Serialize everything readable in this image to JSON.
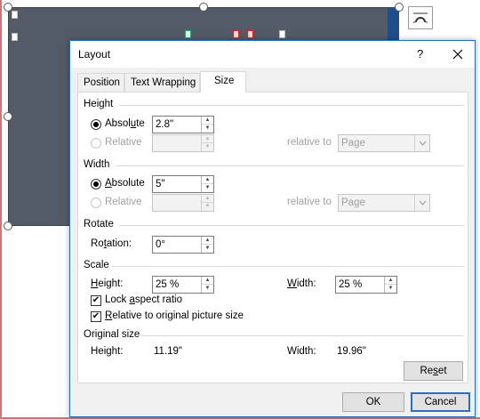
{
  "dialog": {
    "title": "Layout",
    "help": "?",
    "tabs": [
      "Position",
      "Text Wrapping",
      "Size"
    ],
    "active_tab": "Size"
  },
  "height": {
    "section": "Height",
    "absolute_label": "Absolute",
    "absolute_value": "2.8\"",
    "relative_label": "Relative",
    "relative_to_label": "relative to",
    "relative_to_value": "Page"
  },
  "width": {
    "section": "Width",
    "absolute_label": "Absolute",
    "absolute_value": "5\"",
    "relative_label": "Relative",
    "relative_to_label": "relative to",
    "relative_to_value": "Page"
  },
  "rotate": {
    "section": "Rotate",
    "rotation_label": "Rotation:",
    "rotation_value": "0°"
  },
  "scale": {
    "section": "Scale",
    "height_label": "Height:",
    "height_value": "25 %",
    "width_label": "Width:",
    "width_value": "25 %",
    "lock_aspect": "Lock aspect ratio",
    "lock_checked": true,
    "relative_original": "Relative to original picture size",
    "relative_checked": true
  },
  "original": {
    "section": "Original size",
    "height_label": "Height:",
    "height_value": "11.19\"",
    "width_label": "Width:",
    "width_value": "19.96\""
  },
  "buttons": {
    "reset": "Reset",
    "ok": "OK",
    "cancel": "Cancel"
  },
  "colors": {
    "picture_bg": "#535b66",
    "accent": "#2a6ebd"
  }
}
